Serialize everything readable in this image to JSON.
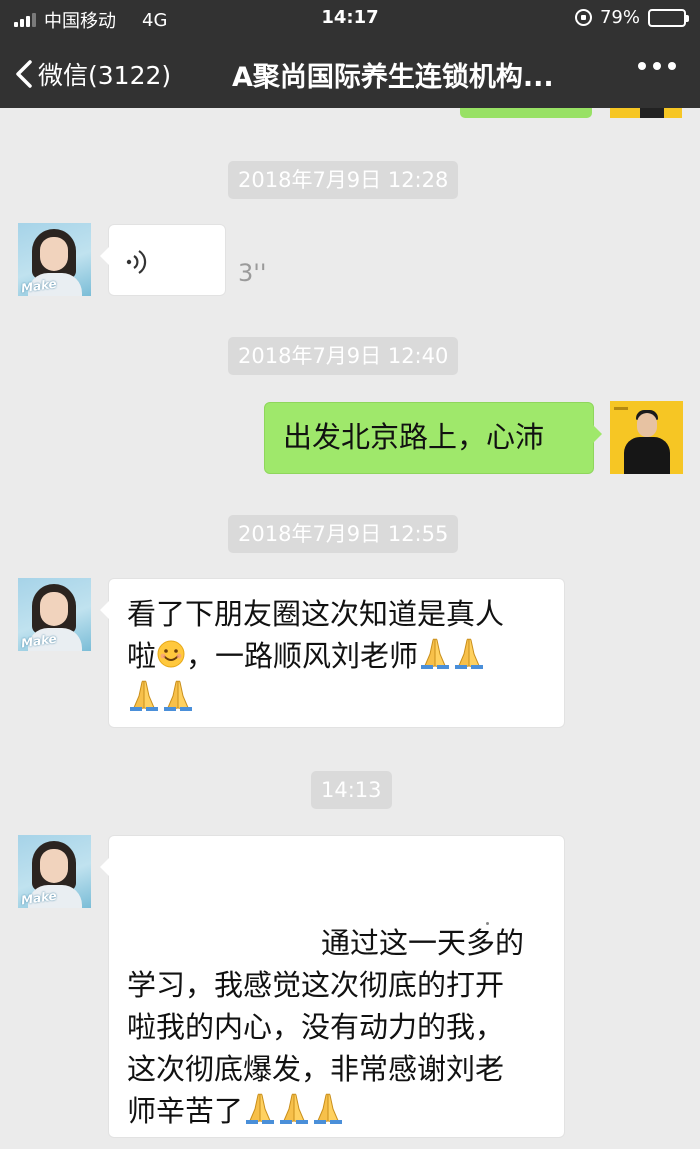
{
  "status_bar": {
    "carrier": "中国移动",
    "network": "4G",
    "time": "14:17",
    "battery": "79%"
  },
  "nav": {
    "back_label": "微信(3122)",
    "title": "A聚尚国际养生连锁机构...",
    "more_icon": "more-dots-icon"
  },
  "messages": {
    "ts1": "2018年7月9日 12:28",
    "voice_duration": "3''",
    "ts2": "2018年7月9日 12:40",
    "sent_text": "出发北京路上，心沛",
    "ts3": "2018年7月9日 12:55",
    "recv_text_line1": "看了下朋友圈这次知道是真人",
    "recv_text_line2a": "啦",
    "recv_text_line2b": "，一路顺风刘老师",
    "ts4": "14:13",
    "long_text_line1": "通过这一天多的",
    "long_text_line2": "学习，我感觉这次彻底的打开",
    "long_text_line3": "啦我的内心，没有动力的我，",
    "long_text_line4": "这次彻底爆发，非常感谢刘老",
    "long_text_line5": "师辛苦了"
  },
  "avatar_overlay_text": "Make",
  "colors": {
    "topbar": "#323232",
    "chat_bg": "#ebebeb",
    "sent_bubble": "#9fe86b",
    "timestamp_bg": "#dadada"
  }
}
